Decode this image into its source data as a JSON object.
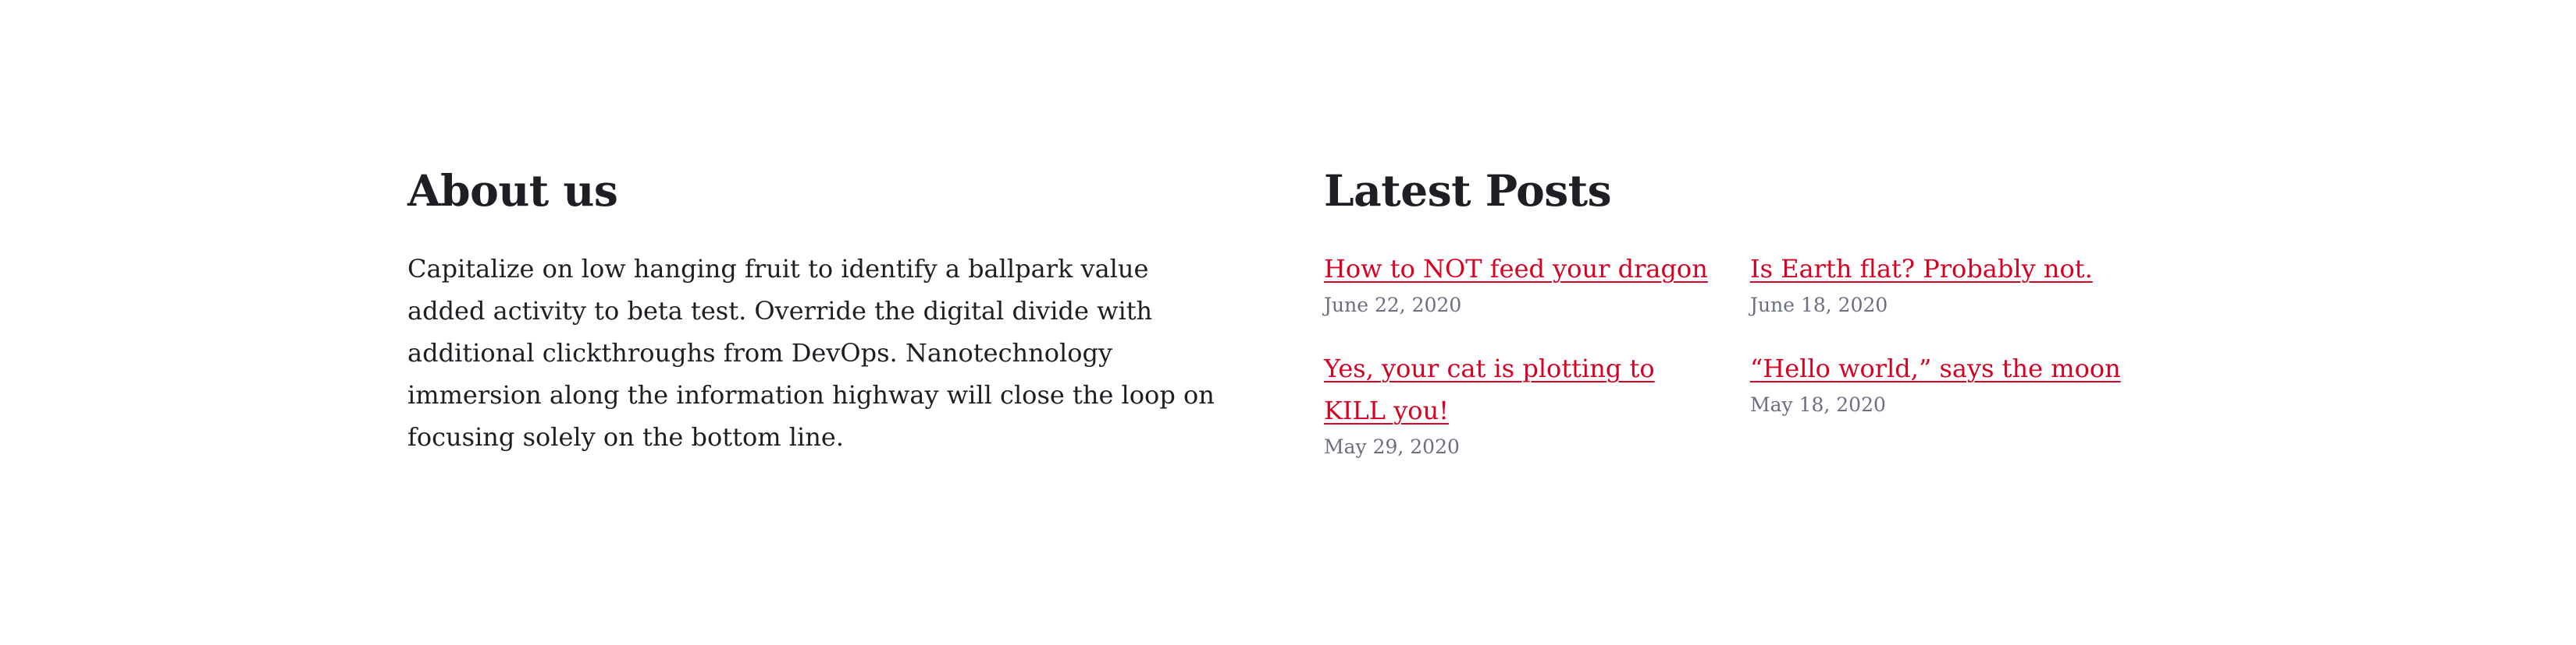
{
  "about": {
    "title": "About us",
    "text": "Capitalize on low hanging fruit to identify a ballpark value added activity to beta test. Override the digital divide with additional clickthroughs from DevOps. Nanotechnology immersion along the information highway will close the loop on focusing solely on the bottom line."
  },
  "latest_posts": {
    "title": "Latest Posts",
    "posts": [
      {
        "title": "How to NOT feed your dragon",
        "date": "June 22, 2020"
      },
      {
        "title": "Is Earth flat? Probably not.",
        "date": "June 18, 2020"
      },
      {
        "title": "Yes, your cat is plotting to KILL you!",
        "date": "May 29, 2020"
      },
      {
        "title": "“Hello world,” says the moon",
        "date": "May 18, 2020"
      }
    ]
  },
  "colors": {
    "text": "#1e1e24",
    "link": "#d60123",
    "date": "#6b6f80",
    "background": "#ffffff"
  }
}
